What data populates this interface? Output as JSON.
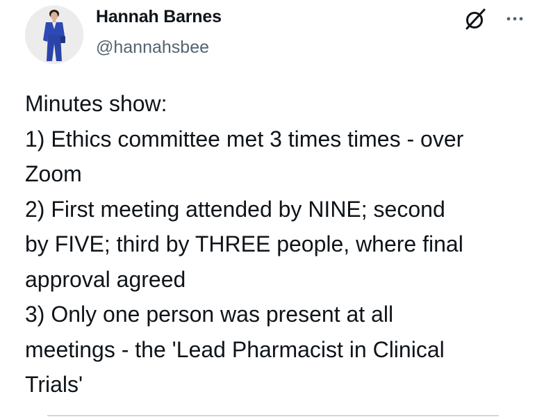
{
  "tweet": {
    "author": {
      "name": "Hannah Barnes",
      "handle": "@hannahsbee",
      "avatar_icon": "profile-photo"
    },
    "icons": {
      "grok": "grok-icon",
      "more": "more-options-icon"
    },
    "lines": [
      "Minutes show:",
      "1) Ethics committee met 3 times times - over",
      "Zoom",
      "2) First meeting attended by NINE; second",
      "by FIVE; third by THREE people, where final",
      "approval agreed",
      "3) Only one person was present at all",
      "meetings - the 'Lead Pharmacist in Clinical",
      "Trials'"
    ]
  },
  "colors": {
    "text": "#0f1419",
    "secondary": "#536471",
    "divider": "#cfd9de",
    "suit": "#2d49b3"
  }
}
